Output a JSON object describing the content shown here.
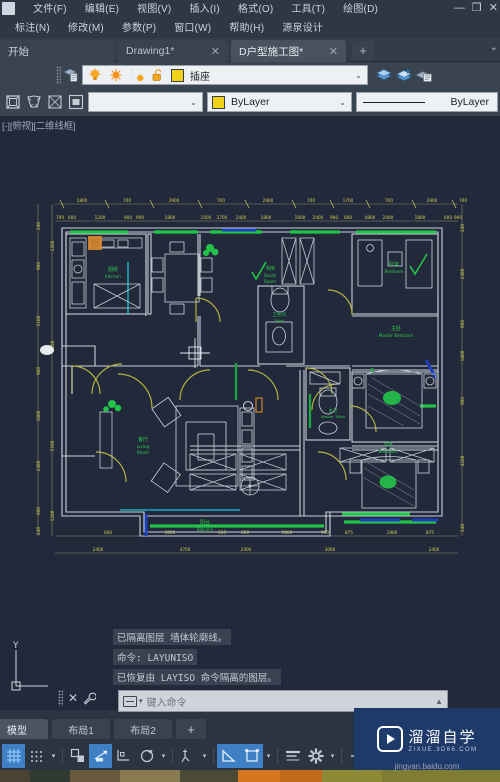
{
  "window": {
    "title": "AutoCAD",
    "controls": {
      "minimize": "—",
      "restore": "❐",
      "close": "✕"
    }
  },
  "menubar": {
    "row1": [
      {
        "label": "文件(F)",
        "name": "menu-file"
      },
      {
        "label": "编辑(E)",
        "name": "menu-edit"
      },
      {
        "label": "视图(V)",
        "name": "menu-view"
      },
      {
        "label": "插入(I)",
        "name": "menu-insert"
      },
      {
        "label": "格式(O)",
        "name": "menu-format"
      },
      {
        "label": "工具(T)",
        "name": "menu-tools"
      },
      {
        "label": "绘图(D)",
        "name": "menu-draw"
      }
    ],
    "row2": [
      {
        "label": "标注(N)",
        "name": "menu-dimension"
      },
      {
        "label": "修改(M)",
        "name": "menu-modify"
      },
      {
        "label": "参数(P)",
        "name": "menu-parametric"
      },
      {
        "label": "窗口(W)",
        "name": "menu-window"
      },
      {
        "label": "帮助(H)",
        "name": "menu-help"
      },
      {
        "label": "源泉设计",
        "name": "menu-yuanquan"
      }
    ]
  },
  "file_tabs": {
    "start_label": "开始",
    "tabs": [
      {
        "label": "Drawing1*",
        "close": "✕",
        "active": false
      },
      {
        "label": "D户型施工图*",
        "close": "✕",
        "active": true
      }
    ],
    "new_tab": "+",
    "overflow_chevron": "⌄"
  },
  "layer_toolbar": {
    "current_layer": "插座",
    "dropdown_chevron": "⌄",
    "icons": [
      "layer-properties-icon",
      "lightbulb-on-icon",
      "sun-freeze-icon",
      "freeze-viewport-icon",
      "unlock-padlock-icon",
      "layer-color-swatch"
    ],
    "right_icons": [
      "make-object-layer-current-icon",
      "layer-previous-icon",
      "layer-match-icon"
    ],
    "color_swatch_hex": "#f2d11a"
  },
  "properties_toolbar": {
    "left_icons": [
      "make-block-icon",
      "edit-block-icon",
      "block-attribute-icon",
      "block-editor-icon"
    ],
    "empty_combo_value": "",
    "color": {
      "value": "ByLayer",
      "swatch_hex": "#f2d11a"
    },
    "linetype": {
      "value": "ByLayer"
    },
    "chevron": "⌄"
  },
  "viewport": {
    "label": "[-][俯视][二维线框]",
    "background_hex": "#22293a",
    "ucs_label": "Y",
    "rooms": [
      {
        "cn": "厨房",
        "en": "Kitchen"
      },
      {
        "cn": "书房",
        "en": "Study Room"
      },
      {
        "cn": "卧室",
        "en": "Bedroom"
      },
      {
        "cn": "卫生间",
        "en": "Toilet"
      },
      {
        "cn": "主卫",
        "en": "Master Toilet"
      },
      {
        "cn": "客厅",
        "en": "Living Room"
      },
      {
        "cn": "阳台",
        "en": "Balcony"
      },
      {
        "cn": "次卧",
        "en": "Bedroom"
      }
    ],
    "dim_top_row1": [
      "1800",
      "700",
      "2900",
      "700",
      "2900",
      "700",
      "1700",
      "700",
      "2900",
      "700"
    ],
    "dim_top_row2": [
      "700",
      "600",
      "1200",
      "900",
      "900",
      "1800",
      "1500",
      "2700",
      "2400",
      "1800",
      "1600",
      "2400",
      "900",
      "600",
      "4800",
      "2400",
      "1800",
      "600",
      "900",
      "600"
    ],
    "dim_bottom_row1": [
      "600",
      "3000",
      "650",
      "600",
      "1800",
      "900",
      "875",
      "1900",
      "875"
    ],
    "dim_bottom_row2": [
      "2400",
      "4700",
      "2400",
      "3000",
      "2400"
    ],
    "dim_left": [
      "240",
      "900",
      "2100",
      "900",
      "1800",
      "2400",
      "900",
      "240"
    ],
    "dim_right": [
      "240",
      "2400",
      "900",
      "1800",
      "900",
      "4200",
      "240"
    ]
  },
  "command_area": {
    "history": [
      "已隔离图层 墙体轮廓线。",
      "命令: LAYUNISO",
      "已恢复由 LAYISO 命令隔离的图层。"
    ],
    "input_placeholder": "键入命令",
    "input_value": "",
    "close_icon": "✕",
    "customize_icon": "✎",
    "expand_chevron": "▲"
  },
  "layout_tabs": {
    "tabs": [
      {
        "label": "模型",
        "active": true,
        "name": "layout-tab-model"
      },
      {
        "label": "布局1",
        "active": false,
        "name": "layout-tab-1"
      },
      {
        "label": "布局2",
        "active": false,
        "name": "layout-tab-2"
      }
    ],
    "add": "+",
    "right_label": "模型"
  },
  "status_bar": {
    "items": [
      {
        "name": "grid-display-icon",
        "on": true,
        "chevron": false
      },
      {
        "name": "snap-mode-icon",
        "on": false,
        "chevron": true
      },
      {
        "name": "ortho-mode-icon",
        "on": false,
        "chevron": false
      },
      {
        "name": "polar-tracking-icon",
        "on": true,
        "chevron": false
      },
      {
        "name": "object-snap-icon",
        "on": false,
        "chevron": false
      },
      {
        "name": "3d-object-snap-icon",
        "on": false,
        "chevron": true
      },
      {
        "name": "object-snap-tracking-icon",
        "on": false,
        "chevron": true
      },
      {
        "name": "dynamic-ucs-icon",
        "on": true,
        "chevron": false
      },
      {
        "name": "selection-cycling-icon",
        "on": true,
        "chevron": true
      },
      {
        "name": "lineweight-icon",
        "on": false,
        "chevron": false
      },
      {
        "name": "settings-gear-icon",
        "on": false,
        "chevron": true
      },
      {
        "name": "add-status-item-icon",
        "on": false,
        "chevron": false
      },
      {
        "name": "customization-icon",
        "on": false,
        "chevron": false
      }
    ]
  },
  "watermark": {
    "title": "溜溜自学",
    "subtitle": "ZIXUE.3D66.COM",
    "url": "jingyan.baidu.com"
  }
}
